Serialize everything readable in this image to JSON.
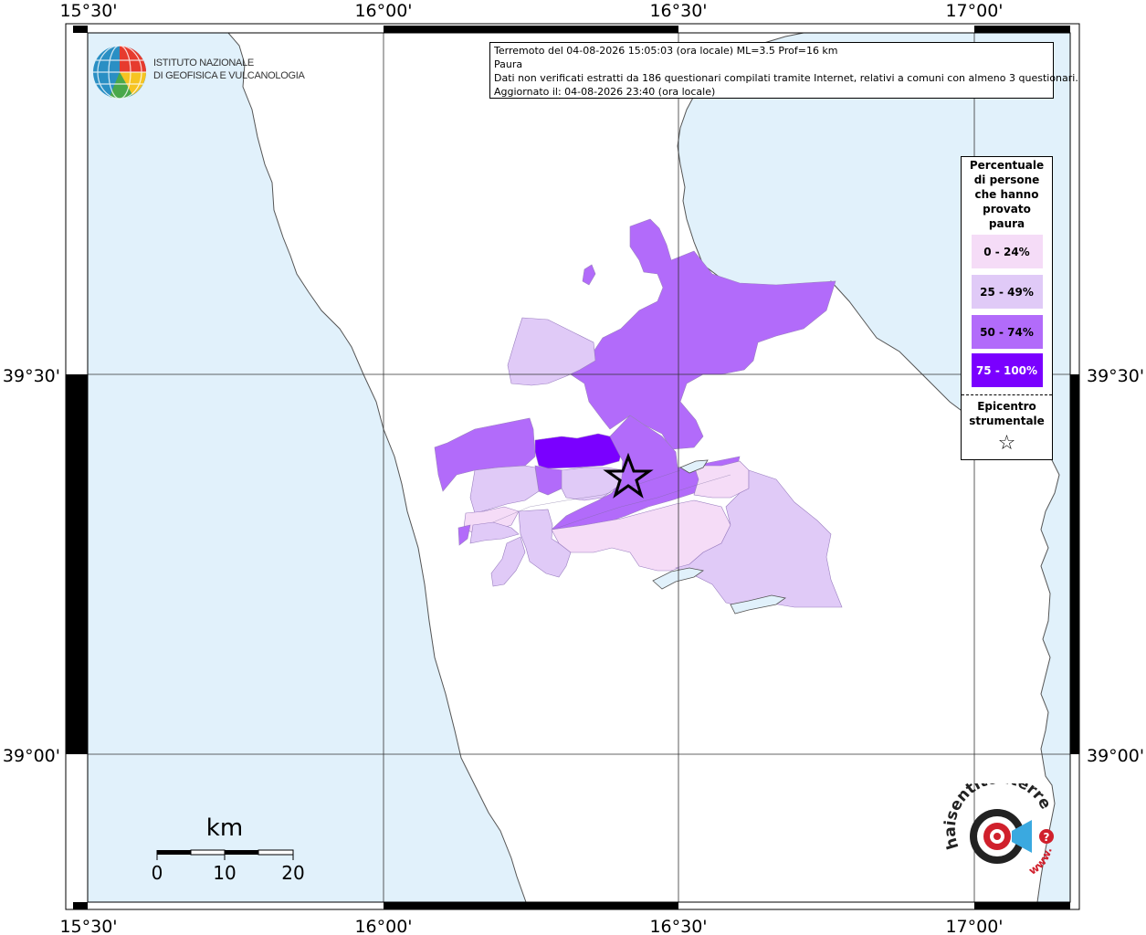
{
  "info": {
    "line1": "Terremoto del 04-08-2026 15:05:03 (ora locale) ML=3.5 Prof=16 km",
    "line2": "Paura",
    "line3": "Dati non verificati estratti da 186 questionari compilati tramite Internet, relativi a comuni con almeno 3 questionari.",
    "line4": "Aggiornato il: 04-08-2026 23:40 (ora locale)"
  },
  "axes": {
    "top": [
      "15°30'",
      "16°00'",
      "16°30'",
      "17°00'"
    ],
    "bottom": [
      "15°30'",
      "16°00'",
      "16°30'",
      "17°00'"
    ],
    "left": [
      "39°30'",
      "39°00'"
    ],
    "right": [
      "39°30'",
      "39°00'"
    ]
  },
  "legend": {
    "title": "Percentuale di persone che hanno provato paura",
    "items": [
      {
        "label": "0 - 24%",
        "color": "#f5dcf7"
      },
      {
        "label": "25 - 49%",
        "color": "#e0caf7"
      },
      {
        "label": "50 - 74%",
        "color": "#b26bfa"
      },
      {
        "label": "75 - 100%",
        "color": "#7a00ff"
      }
    ],
    "epicenter_label": "Epicentro strumentale",
    "epicenter_symbol": "☆"
  },
  "scale": {
    "unit": "km",
    "ticks": [
      "0",
      "10",
      "20"
    ]
  },
  "logos": {
    "ingv_line1": "ISTITUTO NAZIONALE",
    "ingv_line2": "DI GEOFISICA E VULCANOLOGIA",
    "hst_text": "haisentitoilterremoto.it",
    "hst_www": "www."
  },
  "colors": {
    "sea": "#e1f1fb",
    "land": "#ffffff",
    "coast": "#555555"
  }
}
